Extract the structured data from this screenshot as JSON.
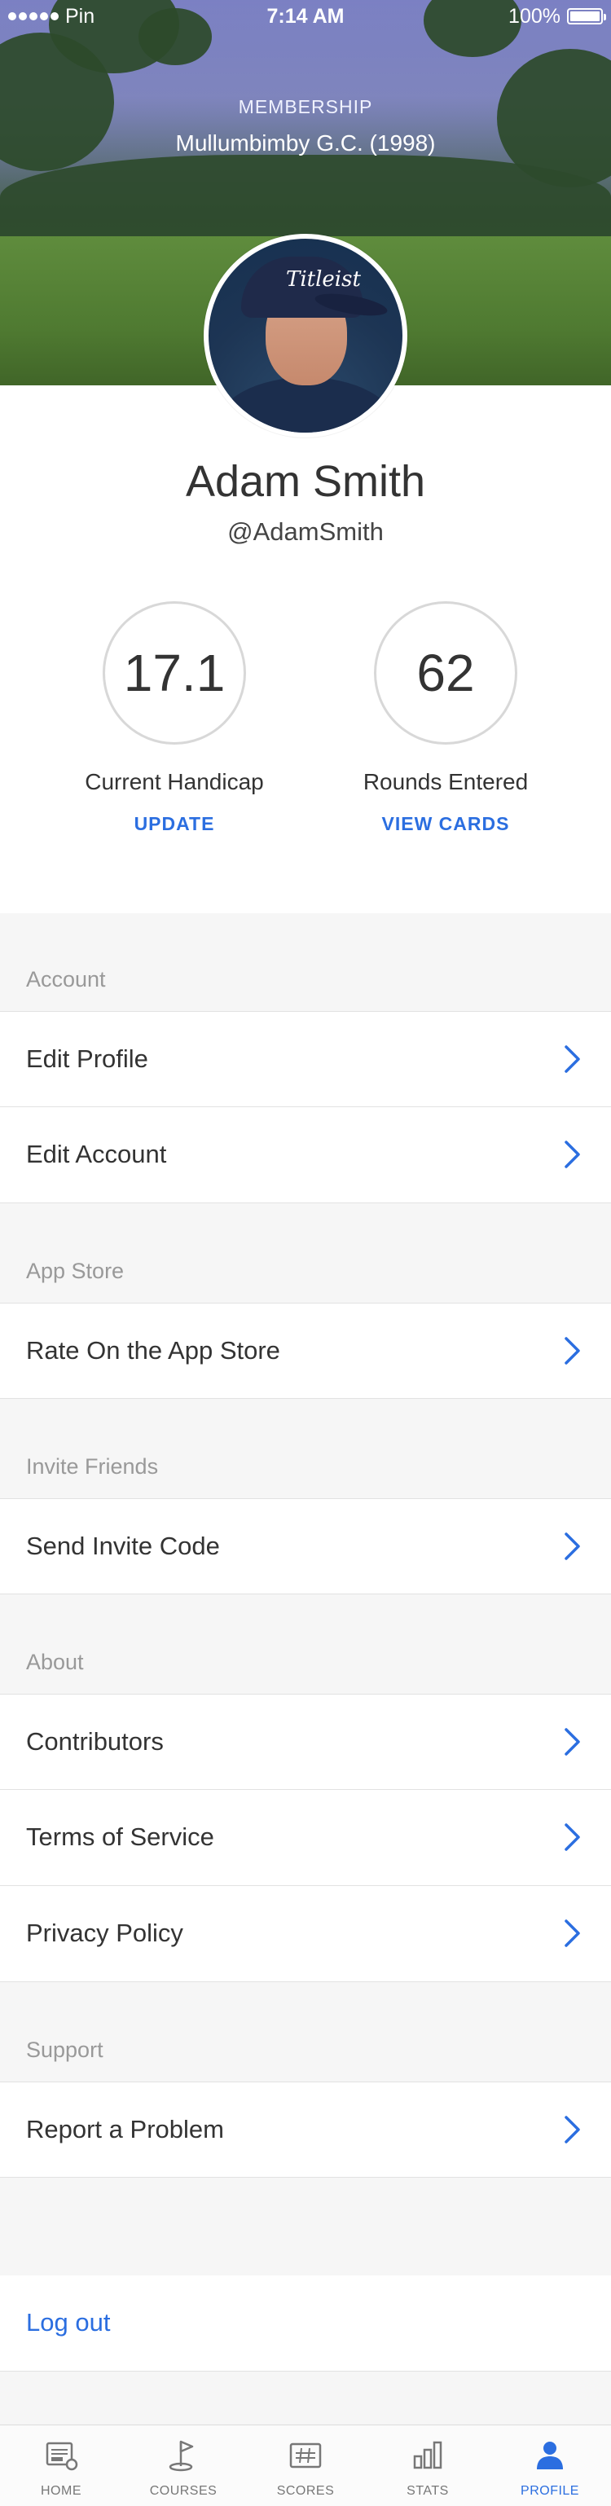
{
  "status_bar": {
    "carrier": "Pin",
    "time": "7:14 AM",
    "battery": "100%"
  },
  "hero": {
    "membership_label": "MEMBERSHIP",
    "club_name": "Mullumbimby G.C. (1998)"
  },
  "profile": {
    "name": "Adam Smith",
    "handle": "@AdamSmith",
    "avatar_cap_logo": "Titleist"
  },
  "stats": {
    "handicap": {
      "value": "17.1",
      "label": "Current Handicap",
      "action": "UPDATE"
    },
    "rounds": {
      "value": "62",
      "label": "Rounds Entered",
      "action": "VIEW CARDS"
    }
  },
  "sections": {
    "account": {
      "header": "Account",
      "items": [
        "Edit Profile",
        "Edit Account"
      ]
    },
    "app_store": {
      "header": "App Store",
      "items": [
        "Rate On the App Store"
      ]
    },
    "invite": {
      "header": "Invite Friends",
      "items": [
        "Send Invite Code"
      ]
    },
    "about": {
      "header": "About",
      "items": [
        "Contributors",
        "Terms of Service",
        "Privacy Policy"
      ]
    },
    "support": {
      "header": "Support",
      "items": [
        "Report a Problem"
      ]
    }
  },
  "logout_label": "Log out",
  "tabbar": {
    "tabs": [
      {
        "label": "HOME",
        "icon": "home-icon"
      },
      {
        "label": "COURSES",
        "icon": "flag-icon"
      },
      {
        "label": "SCORES",
        "icon": "scorecard-icon"
      },
      {
        "label": "STATS",
        "icon": "bar-chart-icon"
      },
      {
        "label": "PROFILE",
        "icon": "person-icon"
      }
    ],
    "active": "PROFILE"
  },
  "colors": {
    "accent": "#2b6ee0",
    "text": "#333333",
    "muted": "#999999",
    "section_bg": "#f6f6f6"
  }
}
